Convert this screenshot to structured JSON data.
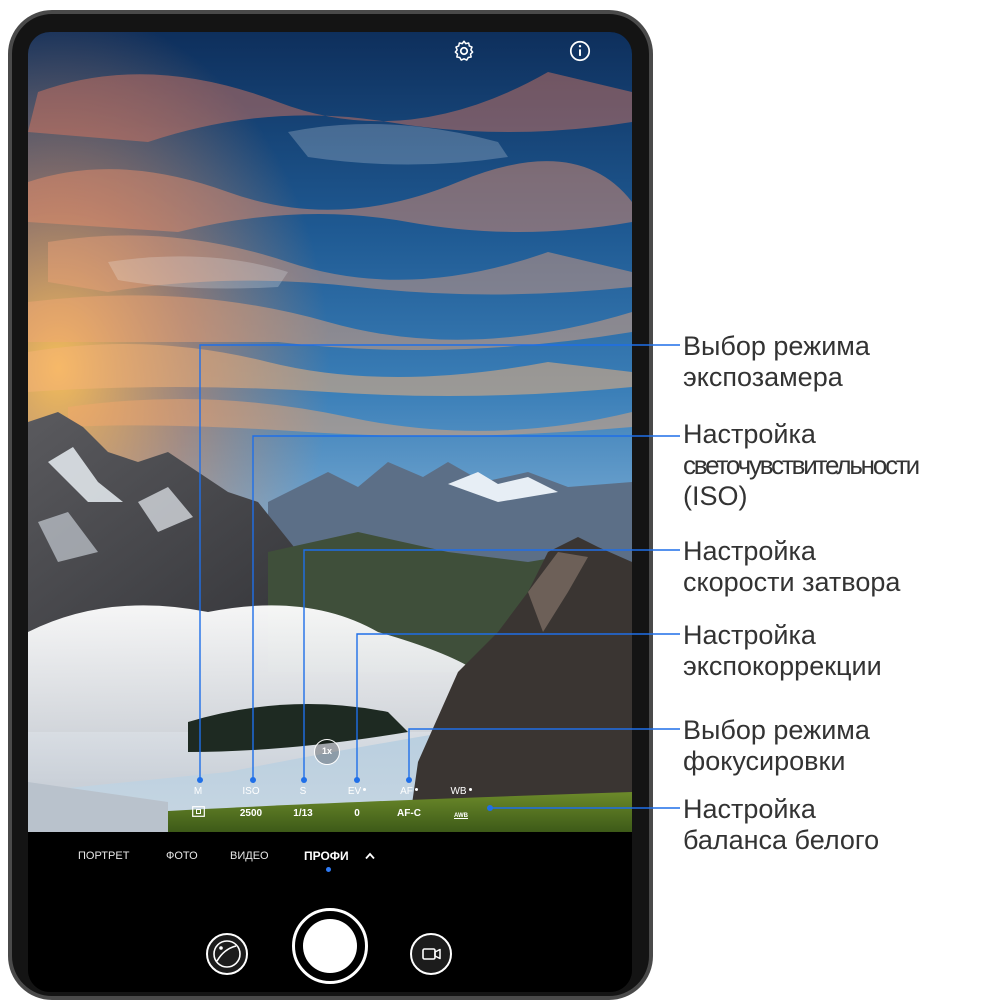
{
  "modes": [
    {
      "label": "ПОРТРЕТ",
      "active": false
    },
    {
      "label": "ФОТО",
      "active": false
    },
    {
      "label": "ВИДЕО",
      "active": false
    },
    {
      "label": "ПРОФИ",
      "active": true
    }
  ],
  "params": [
    {
      "label": "M",
      "value": ""
    },
    {
      "label": "ISO",
      "value": "2500"
    },
    {
      "label": "S",
      "value": "1/13"
    },
    {
      "label": "EV",
      "value": "0"
    },
    {
      "label": "AF",
      "value": "AF-C"
    },
    {
      "label": "WB",
      "value": "AWB"
    }
  ],
  "zoom": "1x",
  "callouts": [
    {
      "line1": "Выбор режима",
      "line2": "экспозамера"
    },
    {
      "line1": "Настройка",
      "line2": "светочувствительности",
      "line3": "(ISO)"
    },
    {
      "line1": "Настройка",
      "line2": "скорости затвора"
    },
    {
      "line1": "Настройка",
      "line2": "экспокоррекции"
    },
    {
      "line1": "Выбор режима",
      "line2": "фокусировки"
    },
    {
      "line1": "Настройка",
      "line2": "баланса белого"
    }
  ],
  "colors": {
    "leader_line": "#1f6fe8",
    "mode_dot": "#2f7bf5",
    "sky_top": "#123a6b",
    "sunset": "#f08a4b"
  },
  "icons": {
    "settings": "gear-icon",
    "info": "info-icon",
    "gallery": "gallery-icon",
    "video": "video-camera-icon",
    "mode_expand": "chevron-up-icon",
    "metering": "metering-icon"
  }
}
